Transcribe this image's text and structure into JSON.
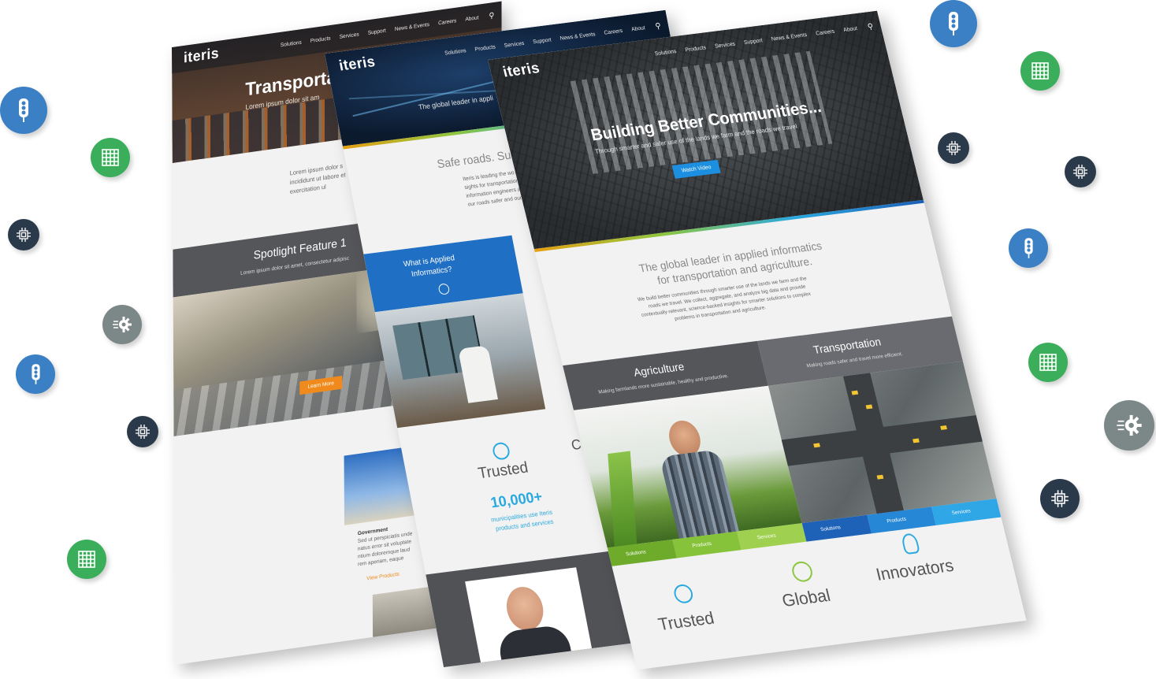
{
  "back_page": {
    "logo": "iteris",
    "nav": [
      "Solutions",
      "Products",
      "Services",
      "Support",
      "News & Events",
      "Careers",
      "About"
    ],
    "hero_title": "Transporta",
    "hero_sub": "Lorem ipsum dolor sit am",
    "intro_lines": [
      "Lorem ipsum dolor s",
      "incididunt ut labore et",
      "exercitation ul"
    ],
    "spotlight_title": "Spotlight Feature 1",
    "spotlight_sub": "Lorem ipsum dolor sit amet, consectetur adipisc",
    "learn_more": "Learn More",
    "gov_title": "Government",
    "gov_lines": [
      "Sed ut perspiciatis unde",
      "natus error sit voluptate",
      "ntium doloremque laud",
      "rem aperiam, eaque"
    ],
    "view_products": "View Products"
  },
  "middle_page": {
    "logo": "iteris",
    "nav": [
      "Solutions",
      "Products",
      "Services",
      "Support",
      "News & Events",
      "Careers",
      "About"
    ],
    "hero_sub": "The global leader in appli",
    "tagline": "Safe roads. Susta",
    "intro_lines": [
      "Iteris is leading the wo",
      "sights for transportation",
      "information engineers an",
      "our roads safer and our"
    ],
    "applied_title_1": "What is Applied",
    "applied_title_2": "Informatics?",
    "trusted": "Trusted",
    "stat_value": "10,000+",
    "stat_line1": "municipalities use Iteris",
    "stat_line2": "products and services",
    "cut_letter": "C"
  },
  "front_page": {
    "logo": "iteris",
    "nav": [
      "Solutions",
      "Products",
      "Services",
      "Support",
      "News & Events",
      "Careers",
      "About"
    ],
    "hero_title": "Building Better Communities...",
    "hero_sub": "Through smarter and safer use of the lands we farm and the roads we travel",
    "watch_video": "Watch Video",
    "tagline_1": "The global leader in applied informatics",
    "tagline_2": "for transportation and agriculture.",
    "body_lines": [
      "We build better communities through smarter use of the lands we farm and the",
      "roads we travel. We collect, aggregate, and analyze big data and provide",
      "contextually-relevant, science-backed insights for smarter solutions to complex",
      "problems in transportation and agriculture."
    ],
    "agriculture_title": "Agriculture",
    "agriculture_sub": "Making farmlands more sustainable, healthy and productive.",
    "transportation_title": "Transportation",
    "transportation_sub": "Making roads safer and travel more efficient.",
    "ag_tabs": [
      "Solutions",
      "Products",
      "Services"
    ],
    "tr_tabs": [
      "Solutions",
      "Products",
      "Services"
    ],
    "pillars": [
      "Trusted",
      "Global",
      "Innovators"
    ]
  },
  "floating_icons": [
    {
      "name": "traffic-light-icon",
      "color": "#3b80c4"
    },
    {
      "name": "grid-icon",
      "color": "#3bae5c"
    },
    {
      "name": "chip-icon",
      "color": "#2b3a4a"
    },
    {
      "name": "gear-icon",
      "color": "#7b8887"
    }
  ]
}
